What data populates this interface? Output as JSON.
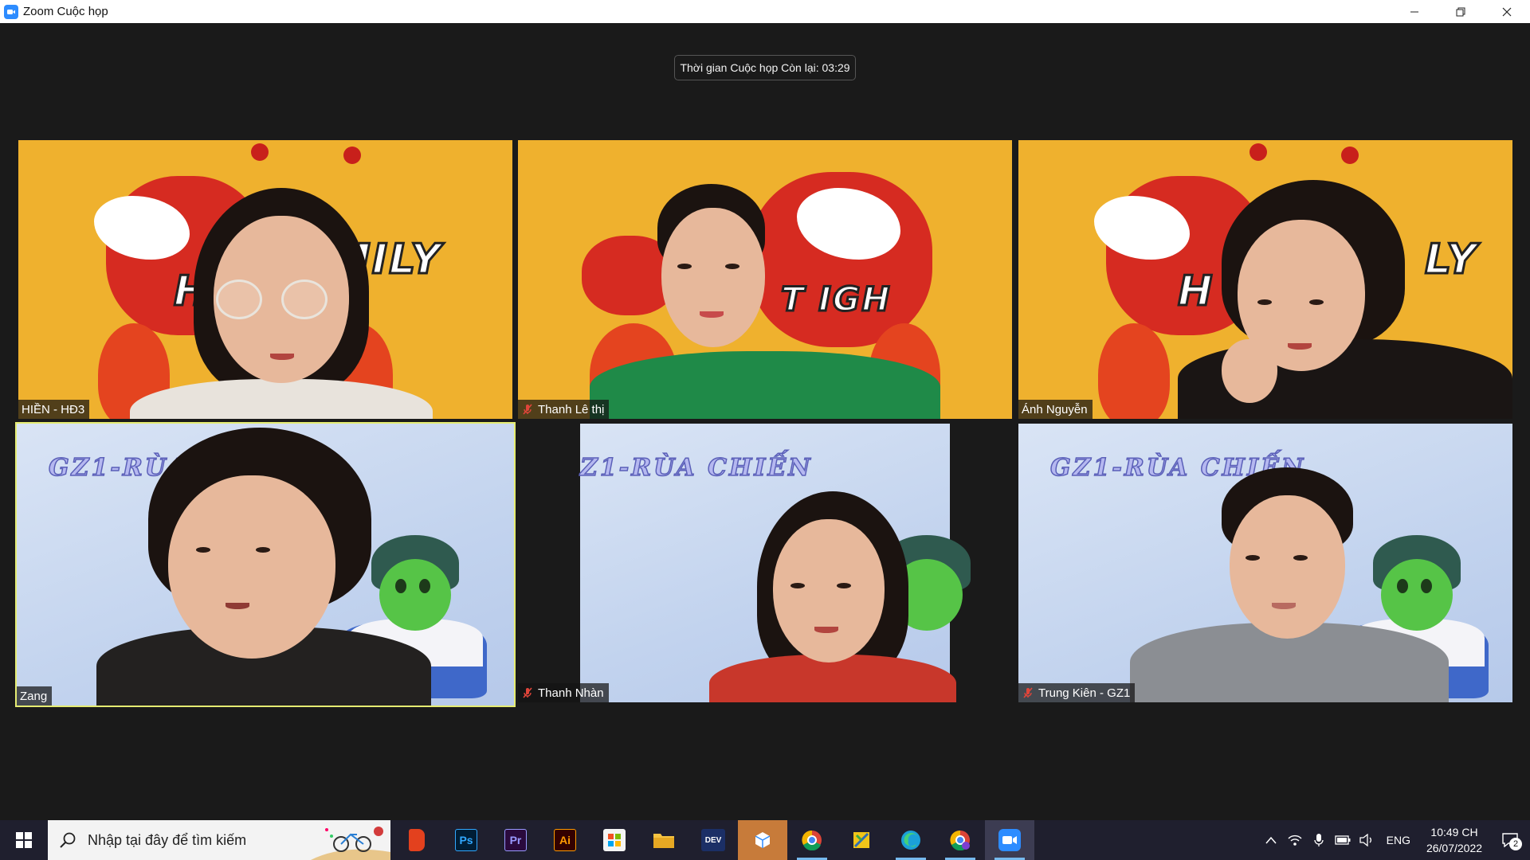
{
  "window": {
    "title": "Zoom Cuộc họp",
    "minimize": "—",
    "restore": "❐",
    "close": "✕"
  },
  "timer": {
    "text": "Thời gian Cuộc họp Còn lại: 03:29"
  },
  "participants": [
    {
      "name": "HIỀN - HĐ3",
      "muted": false,
      "active": false,
      "background": "tiger"
    },
    {
      "name": "Thanh Lê thị",
      "muted": true,
      "active": false,
      "background": "tiger"
    },
    {
      "name": "Ánh Nguyễn",
      "muted": false,
      "active": false,
      "background": "tiger"
    },
    {
      "name": "Zang",
      "muted": false,
      "active": true,
      "background": "turtle"
    },
    {
      "name": "Thanh Nhàn",
      "muted": true,
      "active": false,
      "background": "turtle"
    },
    {
      "name": "Trung Kiên - GZ1",
      "muted": true,
      "active": false,
      "background": "turtle"
    }
  ],
  "poster_text": {
    "tiger_left": "H",
    "tiger_word": "MILY",
    "tiger_mid": "T IGH",
    "tiger_right_h": "H",
    "tiger_right_word": "LY",
    "turtle_banner_1": "GZ1-RÙA",
    "turtle_banner_2": "Z1-RÙA CHIẾN",
    "turtle_banner_3": "GZ1-RÙA CHIẾN"
  },
  "taskbar": {
    "search_placeholder": "Nhập tại đây để tìm kiếm",
    "apps": [
      {
        "name": "office",
        "glyph": "",
        "color": "#e3411e"
      },
      {
        "name": "photoshop",
        "glyph": "Ps",
        "color": "#31a8ff"
      },
      {
        "name": "premiere",
        "glyph": "Pr",
        "color": "#9999ff"
      },
      {
        "name": "illustrator",
        "glyph": "Ai",
        "color": "#ff9a00"
      },
      {
        "name": "store",
        "glyph": "",
        "color": "#0078d4"
      },
      {
        "name": "file-explorer",
        "glyph": "",
        "color": "#f5c342"
      },
      {
        "name": "dev-c",
        "glyph": "DEV",
        "color": "#1b4da3"
      },
      {
        "name": "package",
        "glyph": "",
        "color": "#ffffff"
      },
      {
        "name": "chrome",
        "glyph": "",
        "color": "#db4437"
      },
      {
        "name": "sticky",
        "glyph": "",
        "color": "#f0c419"
      },
      {
        "name": "edge",
        "glyph": "",
        "color": "#1ba0d8"
      },
      {
        "name": "chrome-profile",
        "glyph": "",
        "color": "#db4437"
      },
      {
        "name": "zoom",
        "glyph": "",
        "color": "#2d8cff"
      }
    ],
    "language": "ENG",
    "time": "10:49 CH",
    "date": "26/07/2022",
    "notifications": "2"
  },
  "colors": {
    "active_speaker_border": "#e5ec72",
    "zoom_blue": "#2d8cff",
    "mute_red": "#e0453a"
  }
}
